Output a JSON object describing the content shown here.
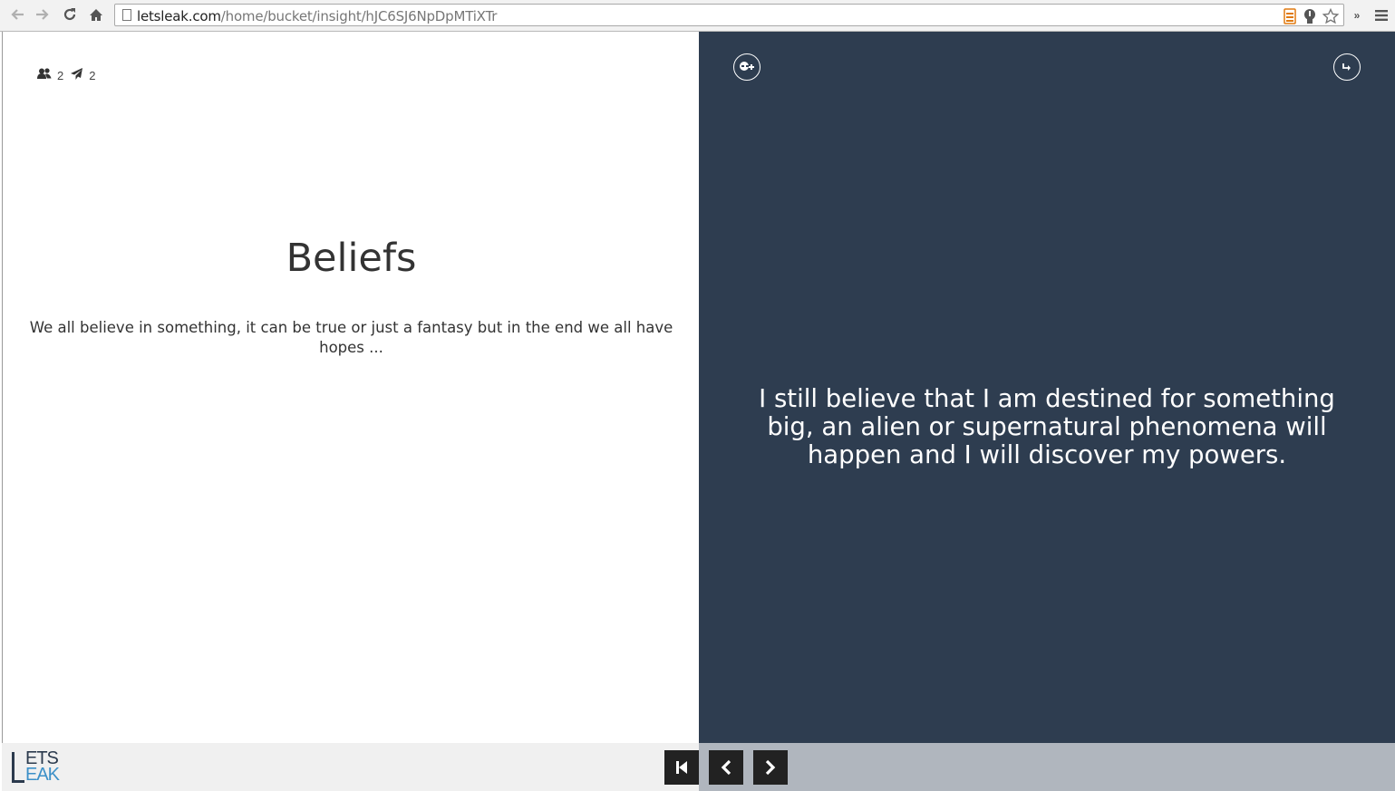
{
  "browser": {
    "url_host": "letsleak.com",
    "url_path": "/home/bucket/insight/hJC6SJ6NpDpMTiXTr",
    "icons": [
      "back-icon",
      "forward-icon",
      "reload-icon",
      "home-icon",
      "page-icon",
      "rss-icon",
      "extension-icon",
      "star-icon",
      "more-extensions-icon",
      "menu-icon"
    ]
  },
  "insight": {
    "members_count": "2",
    "shares_count": "2",
    "title": "Beliefs",
    "description": "We all believe in something, it can be true or just a fantasy but in the end we all have hopes ..."
  },
  "card": {
    "text": "I still believe that I am destined for something big, an alien or supernatural phenomena will happen and I will discover my powers.",
    "background_color": "#2e3d50"
  },
  "footer": {
    "logo_top": "ETS",
    "logo_bottom": "EAK",
    "logo_colors": {
      "dark": "#2b3a4d",
      "blue": "#3c90c8"
    }
  }
}
